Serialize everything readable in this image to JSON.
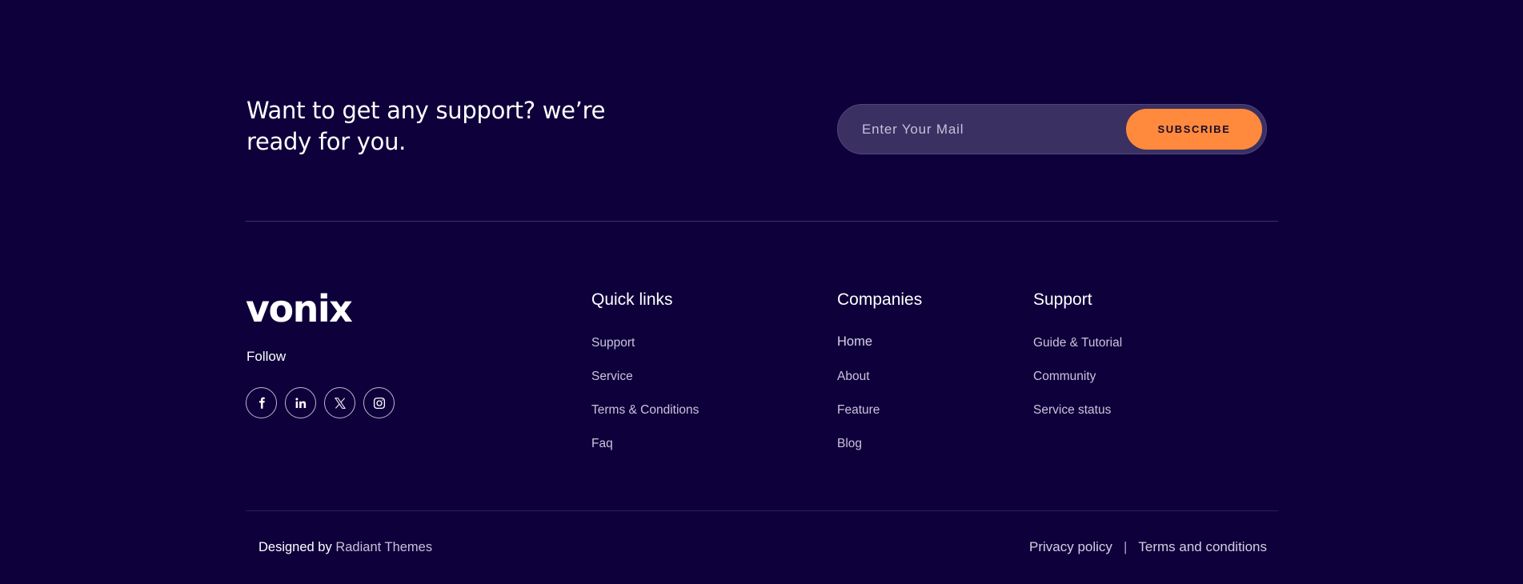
{
  "cta": {
    "line1": "Want to get any support? we’re",
    "line2": "ready for you."
  },
  "newsletter": {
    "placeholder": "Enter Your Mail",
    "button": "SUBSCRIBE",
    "accent_color": "#ff8a3d"
  },
  "brand": {
    "logo": "vonix",
    "follow": "Follow",
    "socials": [
      "facebook-icon",
      "linkedin-icon",
      "x-icon",
      "instagram-icon"
    ]
  },
  "columns": {
    "quick": {
      "title": "Quick links",
      "items": [
        "Support",
        "Service",
        "Terms & Conditions",
        "Faq"
      ]
    },
    "companies": {
      "title": "Companies",
      "items": [
        "Home",
        "About",
        "Feature",
        "Blog"
      ]
    },
    "support": {
      "title": "Support",
      "items": [
        "Guide & Tutorial",
        "Community",
        "Service status"
      ]
    }
  },
  "bottom": {
    "designed_by": "Designed by",
    "designer": "Radiant Themes",
    "privacy": "Privacy policy",
    "separator": "|",
    "terms": "Terms and conditions"
  },
  "colors": {
    "background": "#0e003b",
    "accent": "#ff8a3d"
  }
}
